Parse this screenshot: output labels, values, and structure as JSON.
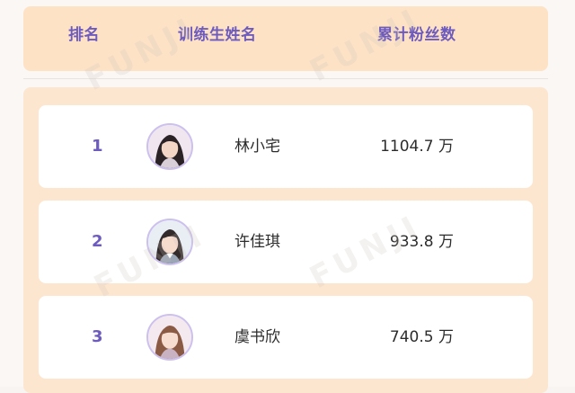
{
  "header": {
    "rank_label": "排名",
    "name_label": "训练生姓名",
    "fans_label": "累计粉丝数"
  },
  "rows": [
    {
      "rank": "1",
      "name": "林小宅",
      "fans": "1104.7 万"
    },
    {
      "rank": "2",
      "name": "许佳琪",
      "fans": "933.8 万"
    },
    {
      "rank": "3",
      "name": "虞书欣",
      "fans": "740.5 万"
    }
  ],
  "watermark": "FUNJI",
  "colors": {
    "accent_purple": "#6d5bbd",
    "header_bg": "#fde2c6",
    "list_bg": "#fde6cf",
    "card_bg": "#ffffff"
  }
}
